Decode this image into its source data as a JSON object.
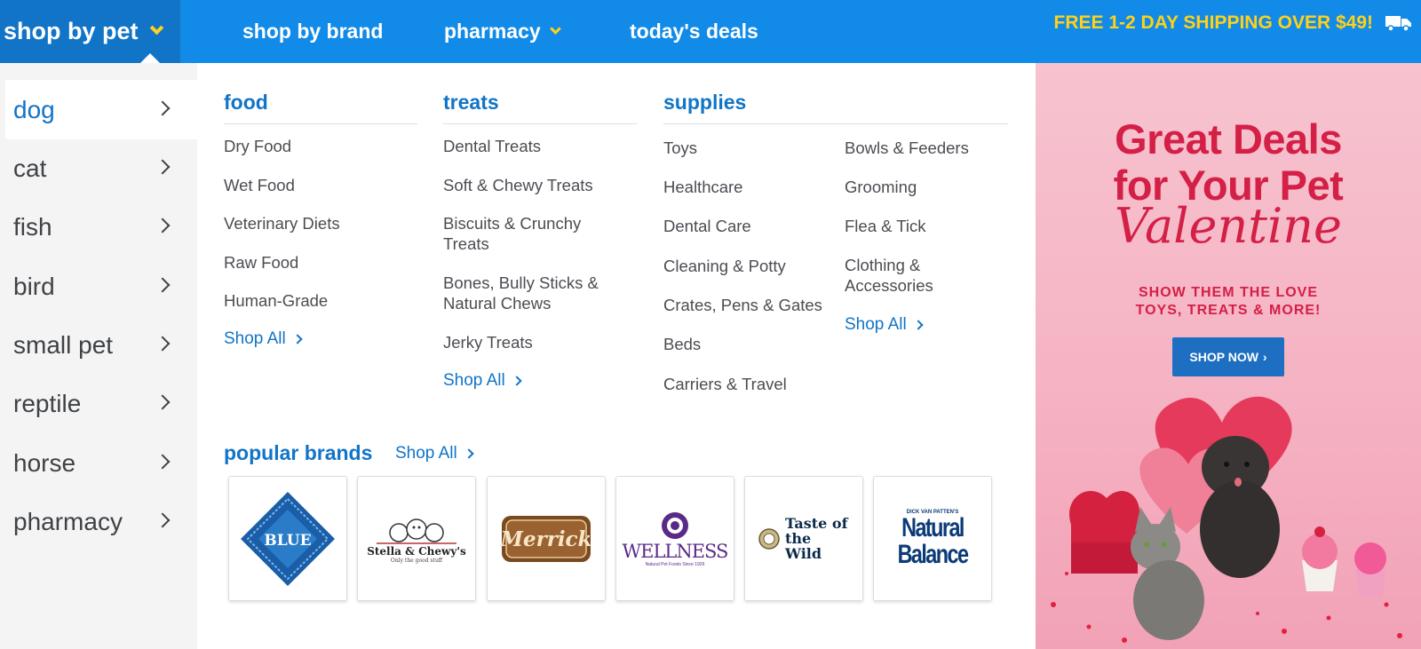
{
  "nav": {
    "shop_by_pet": "shop by pet",
    "shop_by_brand": "shop by brand",
    "pharmacy": "pharmacy",
    "todays_deals": "today's deals",
    "promo": "FREE 1-2 DAY SHIPPING OVER $49!"
  },
  "sidebar": {
    "items": [
      {
        "label": "dog"
      },
      {
        "label": "cat"
      },
      {
        "label": "fish"
      },
      {
        "label": "bird"
      },
      {
        "label": "small pet"
      },
      {
        "label": "reptile"
      },
      {
        "label": "horse"
      },
      {
        "label": "pharmacy"
      }
    ]
  },
  "food": {
    "title": "food",
    "links": [
      "Dry Food",
      "Wet Food",
      "Veterinary Diets",
      "Raw Food",
      "Human-Grade"
    ],
    "shop_all": "Shop All"
  },
  "treats": {
    "title": "treats",
    "links": [
      "Dental Treats",
      "Soft & Chewy Treats",
      "Biscuits & Crunchy Treats",
      "Bones, Bully Sticks & Natural Chews",
      "Jerky Treats"
    ],
    "shop_all": "Shop All"
  },
  "supplies": {
    "title": "supplies",
    "left_links": [
      "Toys",
      "Healthcare",
      "Dental Care",
      "Cleaning & Potty",
      "Crates, Pens & Gates",
      "Beds",
      "Carriers & Travel"
    ],
    "right_links": [
      "Bowls & Feeders",
      "Grooming",
      "Flea & Tick",
      "Clothing & Accessories"
    ],
    "shop_all": "Shop All"
  },
  "brands": {
    "title": "popular brands",
    "shop_all": "Shop All",
    "items": [
      {
        "name": "BLUE"
      },
      {
        "name": "Stella & Chewy's",
        "tagline": "Only the good stuff"
      },
      {
        "name": "Merrick"
      },
      {
        "name": "WELLNESS",
        "tagline": "Natural Pet Foods Since 1926"
      },
      {
        "name": "Taste of the Wild"
      },
      {
        "name": "Natural Balance",
        "tagline": "DICK VAN PATTEN'S"
      }
    ]
  },
  "ad": {
    "headline_1": "Great Deals",
    "headline_2": "for Your Pet",
    "script": "Valentine",
    "sub_1": "SHOW THEM THE LOVE",
    "sub_2": "TOYS, TREATS & MORE!",
    "button": "SHOP NOW"
  },
  "colors": {
    "nav_blue": "#128be8",
    "active_blue": "#1174c7",
    "promo_yellow": "#ffd11a",
    "ad_red": "#d41f47",
    "ad_pink": "#f5b3c3"
  }
}
